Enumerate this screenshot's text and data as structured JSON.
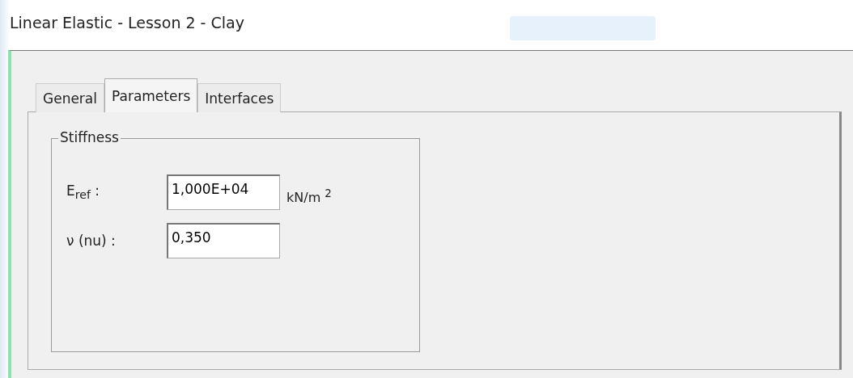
{
  "window": {
    "title": "Linear Elastic - Lesson 2 - Clay"
  },
  "tabs": [
    {
      "label": "General",
      "selected": false
    },
    {
      "label": "Parameters",
      "selected": true
    },
    {
      "label": "Interfaces",
      "selected": false
    }
  ],
  "group": {
    "title": "Stiffness",
    "fields": [
      {
        "label": "E$_{ref}$ :",
        "value": "1,000E+04",
        "unit": "kN/m $^{2}$"
      },
      {
        "label": "ν (nu) :",
        "value": "0,350"
      }
    ]
  }
}
